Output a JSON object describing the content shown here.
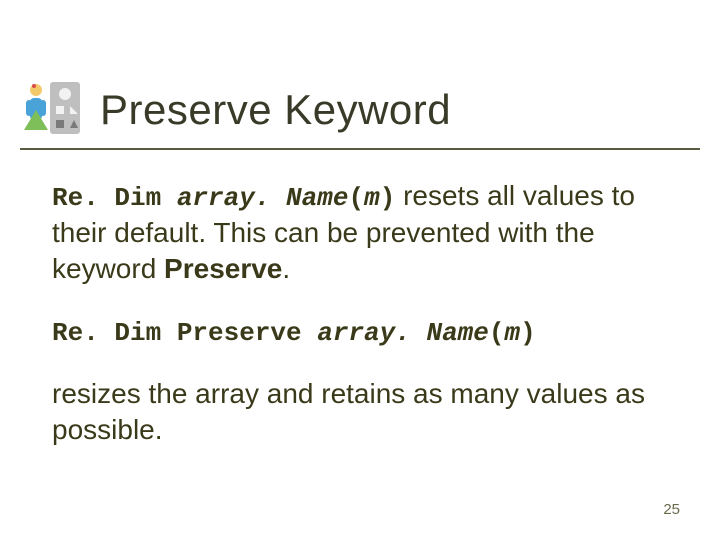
{
  "title": "Preserve Keyword",
  "p1": {
    "c1": "Re. Dim ",
    "c2": "array. Name",
    "c3": "(",
    "c4": "m",
    "c5": ")",
    "t1": "  resets all values to their default. This can be prevented with the keyword ",
    "kw": "Preserve",
    "t2": "."
  },
  "p2": {
    "c1": "Re. Dim Preserve ",
    "c2": "array. Name",
    "c3": "(",
    "c4": "m",
    "c5": ")"
  },
  "p3": "resizes the array and retains as many values as possible.",
  "page_number": "25"
}
